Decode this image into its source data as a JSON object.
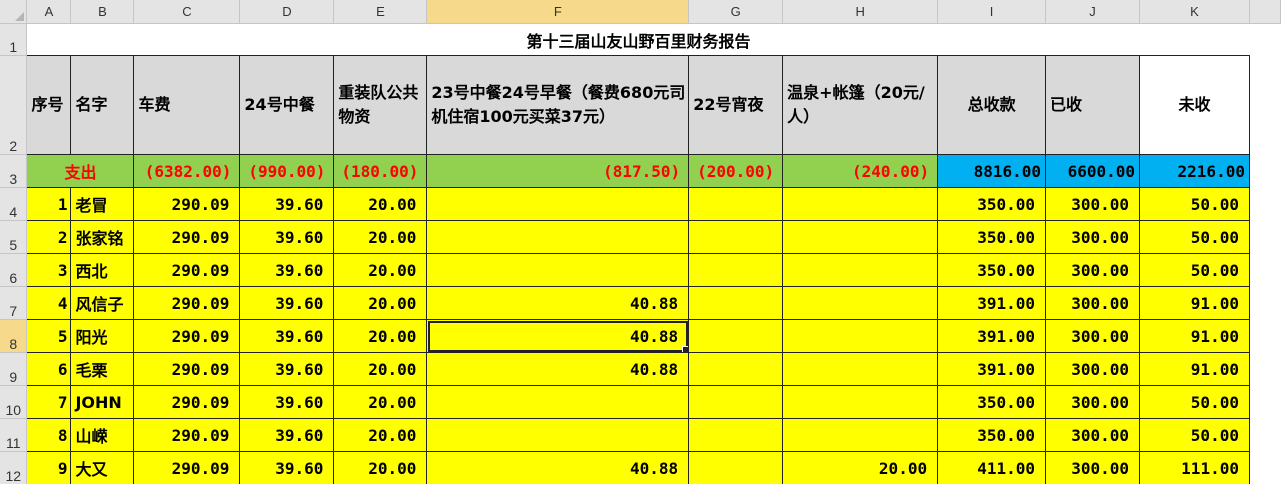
{
  "column_headers": [
    "A",
    "B",
    "C",
    "D",
    "E",
    "F",
    "G",
    "H",
    "I",
    "J",
    "K"
  ],
  "row_numbers": [
    "1",
    "2",
    "3",
    "4",
    "5",
    "6",
    "7",
    "8",
    "9",
    "10",
    "11",
    "12"
  ],
  "selected_cell": "F8",
  "colors": {
    "expense_row": "#92d050",
    "expense_text": "#ff0000",
    "totals_fill": "#00b0f0",
    "data_fill": "#ffff00",
    "header_fill": "#d9d9d9"
  },
  "title": "第十三届山友山野百里财务报告",
  "headers": {
    "index": "序号",
    "name": "名字",
    "fare": "车费",
    "lunch24": "24号中餐",
    "gear": "重装队公共物资",
    "meals": "23号中餐24号早餐（餐费680元司机住宿100元买菜37元）",
    "snack22": "22号宵夜",
    "spring": "温泉+帐篷（20元/人）",
    "total": "总收款",
    "paid": "已收",
    "unpaid": "未收"
  },
  "expense_row": {
    "label": "支出",
    "fare": "(6382.00)",
    "lunch24": "(990.00)",
    "gear": "(180.00)",
    "meals": "(817.50)",
    "snack22": "(200.00)",
    "spring": "(240.00)",
    "total": "8816.00",
    "paid": "6600.00",
    "unpaid": "2216.00"
  },
  "rows": [
    {
      "index": "1",
      "name": "老冒",
      "fare": "290.09",
      "lunch24": "39.60",
      "gear": "20.00",
      "meals": "",
      "snack22": "",
      "spring": "",
      "total": "350.00",
      "paid": "300.00",
      "unpaid": "50.00"
    },
    {
      "index": "2",
      "name": "张家铭",
      "fare": "290.09",
      "lunch24": "39.60",
      "gear": "20.00",
      "meals": "",
      "snack22": "",
      "spring": "",
      "total": "350.00",
      "paid": "300.00",
      "unpaid": "50.00"
    },
    {
      "index": "3",
      "name": "西北",
      "fare": "290.09",
      "lunch24": "39.60",
      "gear": "20.00",
      "meals": "",
      "snack22": "",
      "spring": "",
      "total": "350.00",
      "paid": "300.00",
      "unpaid": "50.00"
    },
    {
      "index": "4",
      "name": "风信子",
      "fare": "290.09",
      "lunch24": "39.60",
      "gear": "20.00",
      "meals": "40.88",
      "snack22": "",
      "spring": "",
      "total": "391.00",
      "paid": "300.00",
      "unpaid": "91.00"
    },
    {
      "index": "5",
      "name": "阳光",
      "fare": "290.09",
      "lunch24": "39.60",
      "gear": "20.00",
      "meals": "40.88",
      "snack22": "",
      "spring": "",
      "total": "391.00",
      "paid": "300.00",
      "unpaid": "91.00"
    },
    {
      "index": "6",
      "name": "毛栗",
      "fare": "290.09",
      "lunch24": "39.60",
      "gear": "20.00",
      "meals": "40.88",
      "snack22": "",
      "spring": "",
      "total": "391.00",
      "paid": "300.00",
      "unpaid": "91.00"
    },
    {
      "index": "7",
      "name": "JOHN",
      "fare": "290.09",
      "lunch24": "39.60",
      "gear": "20.00",
      "meals": "",
      "snack22": "",
      "spring": "",
      "total": "350.00",
      "paid": "300.00",
      "unpaid": "50.00"
    },
    {
      "index": "8",
      "name": "山嵘",
      "fare": "290.09",
      "lunch24": "39.60",
      "gear": "20.00",
      "meals": "",
      "snack22": "",
      "spring": "",
      "total": "350.00",
      "paid": "300.00",
      "unpaid": "50.00"
    },
    {
      "index": "9",
      "name": "大又",
      "fare": "290.09",
      "lunch24": "39.60",
      "gear": "20.00",
      "meals": "40.88",
      "snack22": "",
      "spring": "20.00",
      "total": "411.00",
      "paid": "300.00",
      "unpaid": "111.00"
    }
  ]
}
